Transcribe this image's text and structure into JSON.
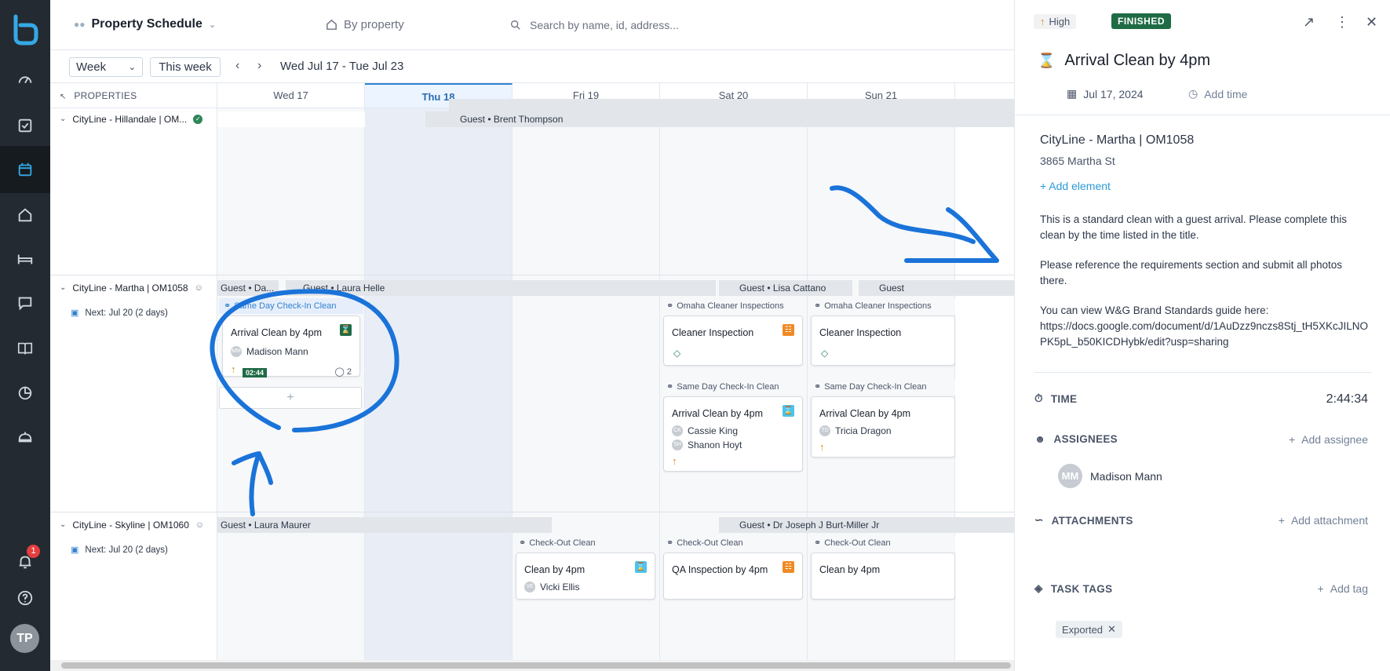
{
  "nav": {
    "notification_count": "1",
    "avatar_initials": "TP"
  },
  "header": {
    "title": "Property Schedule",
    "view_mode": "By property",
    "search_placeholder": "Search by name, id, address..."
  },
  "toolbar": {
    "period_select": "Week",
    "this_week": "This week",
    "date_range": "Wed Jul 17 - Tue Jul 23"
  },
  "grid": {
    "properties_header": "PROPERTIES",
    "days": [
      "Wed 17",
      "Thu 18",
      "Fri 19",
      "Sat 20",
      "Sun 21"
    ],
    "rows": [
      {
        "name": "CityLine - Hillandale | OM...",
        "guests": [
          "Guest • Brent Thompson"
        ]
      },
      {
        "name": "CityLine - Martha | OM1058",
        "next": "Next: Jul 20 (2 days)",
        "guests": [
          "Guest • Da...",
          "Guest • Laura Helle",
          "Guest • Lisa Cattano",
          "Guest"
        ],
        "tasks": [
          {
            "label": "Same Day Check-In Clean",
            "title": "Arrival Clean by 4pm",
            "people": [
              "Madison Mann"
            ],
            "initials": [
              "MM"
            ],
            "timer": "02:44",
            "comments": "2"
          },
          {
            "label": "Omaha Cleaner Inspections",
            "title": "Cleaner Inspection"
          },
          {
            "label": "Omaha Cleaner Inspections",
            "title": "Cleaner Inspection"
          },
          {
            "label": "Same Day Check-In Clean",
            "title": "Arrival Clean by 4pm",
            "people": [
              "Cassie King",
              "Shanon Hoyt"
            ],
            "initials": [
              "CK",
              "SH"
            ]
          },
          {
            "label": "Same Day Check-In Clean",
            "title": "Arrival Clean by 4pm",
            "people": [
              "Tricia Dragon"
            ],
            "initials": [
              "TD"
            ]
          }
        ]
      },
      {
        "name": "CityLine - Skyline | OM1060",
        "next": "Next: Jul 20 (2 days)",
        "guests": [
          "Guest • Laura Maurer",
          "Guest • Dr Joseph J Burt-Miller Jr"
        ],
        "tasks": [
          {
            "label": "Check-Out Clean",
            "title": "Clean by 4pm",
            "people": [
              "Vicki Ellis"
            ],
            "initials": [
              "VE"
            ]
          },
          {
            "label": "Check-Out Clean",
            "title": "QA Inspection by 4pm"
          },
          {
            "label": "Check-Out Clean",
            "title": "Clean by 4pm"
          }
        ]
      }
    ]
  },
  "panel": {
    "priority": "High",
    "status": "FINISHED",
    "title": "Arrival Clean by 4pm",
    "date": "Jul 17, 2024",
    "add_time": "Add time",
    "property": "CityLine - Martha | OM1058",
    "address": "3865 Martha St",
    "add_element": "+ Add element",
    "desc1": "This is a standard clean with a guest arrival. Please complete this clean by the time listed in the title.",
    "desc2": "Please reference the requirements section and submit all photos there.",
    "desc3": "You can view W&G Brand Standards guide here:",
    "desc_link": "https://docs.google.com/document/d/1AuDzz9nczs8Stj_tH5XKcJILNOPK5pL_b50KICDHybk/edit?usp=sharing",
    "time_label": "TIME",
    "time_value": "2:44:34",
    "assignees_label": "ASSIGNEES",
    "add_assignee": "Add assignee",
    "assignee_name": "Madison Mann",
    "assignee_initials": "MM",
    "attachments_label": "ATTACHMENTS",
    "add_attachment": "Add attachment",
    "task_tags_label": "TASK TAGS",
    "add_tag": "Add tag",
    "tag": "Exported"
  },
  "colors": {
    "nav_bg": "#232a31",
    "accent_blue": "#3182ce",
    "finished_green": "#1f6b45",
    "priority_orange": "#dd8a1c",
    "annotation_blue": "#1a73d9"
  }
}
